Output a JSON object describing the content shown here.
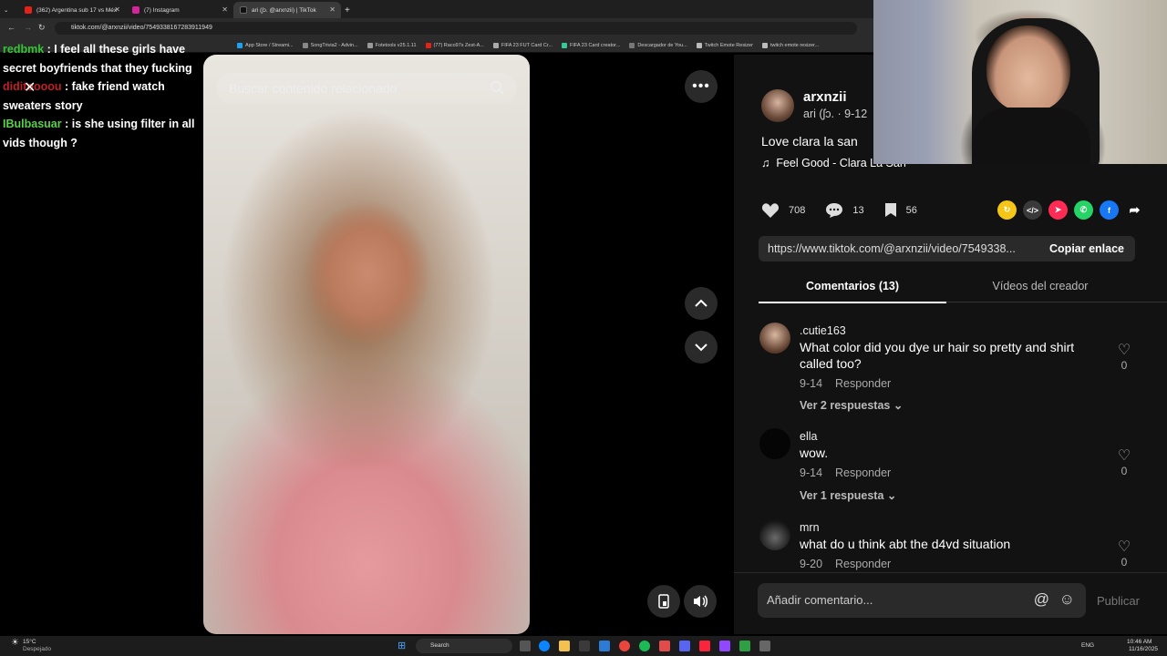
{
  "browser": {
    "tabs": [
      {
        "label": "(362) Argentina sub 17 vs Méx",
        "color": "#e62117"
      },
      {
        "label": "(7) Instagram",
        "color": "#d6249f"
      },
      {
        "label": "ari (ʃɔ. @arxnzii) | TikTok",
        "color": "#111111"
      }
    ],
    "url": "tiktok.com/@arxnzii/video/7549338167283911949",
    "bookmarks": [
      "App Store / Streami...",
      "SongTrivia2 - Advin...",
      "Fotetools v25.1.11",
      "(77) Raco97s Zest-A...",
      "FIFA 23 FUT Card Cr...",
      "FIFA 23 Card creator...",
      "Descargador de You...",
      "Twitch Emote Resizer",
      "twitch emote resizer..."
    ]
  },
  "chat": [
    {
      "user": "redbmk",
      "color": "#35c435",
      "text": "I feel all these girls have secret boyfriends that they fucking"
    },
    {
      "user": "diditoooou",
      "color": "#c0202a",
      "text": "fake friend watch sweaters story"
    },
    {
      "user": "IBulbasuar",
      "color": "#5ad04a",
      "text": "is she using filter in all vids though ?"
    }
  ],
  "video": {
    "search_placeholder": "Buscar contenido relacionado"
  },
  "post": {
    "username": "arxnzii",
    "subtitle": "ari (ʃɔ. · 9-12",
    "caption": "Love clara la san",
    "music": "Feel Good - Clara La San",
    "likes": "708",
    "comments": "13",
    "saves": "56",
    "link": "https://www.tiktok.com/@arxnzii/video/7549338...",
    "copy_label": "Copiar enlace",
    "share_colors": [
      "#f5c518",
      "#3a3a3a",
      "#fe2c55",
      "#25d366",
      "#1877f2"
    ]
  },
  "tabs": {
    "comments": "Comentarios (13)",
    "creator_videos": "Vídeos del creador"
  },
  "comments": [
    {
      "name": ".cutie163",
      "text": "What color did you dye ur hair so pretty and shirt called too?",
      "date": "9-14",
      "reply": "Responder",
      "replies": "Ver 2 respuestas",
      "likes": "0"
    },
    {
      "name": "ella",
      "text": "wow.",
      "date": "9-14",
      "reply": "Responder",
      "replies": "Ver 1 respuesta",
      "likes": "0"
    },
    {
      "name": "mrn",
      "text": "what do u think abt the d4vd situation",
      "date": "9-20",
      "reply": "Responder",
      "likes": "0"
    }
  ],
  "input": {
    "placeholder": "Añadir comentario...",
    "publish": "Publicar"
  },
  "taskbar": {
    "weather_temp": "15°C",
    "weather_desc": "Despejado",
    "search": "Search",
    "lang": "ENG",
    "time": "10:46 AM",
    "date": "11/16/2025"
  }
}
